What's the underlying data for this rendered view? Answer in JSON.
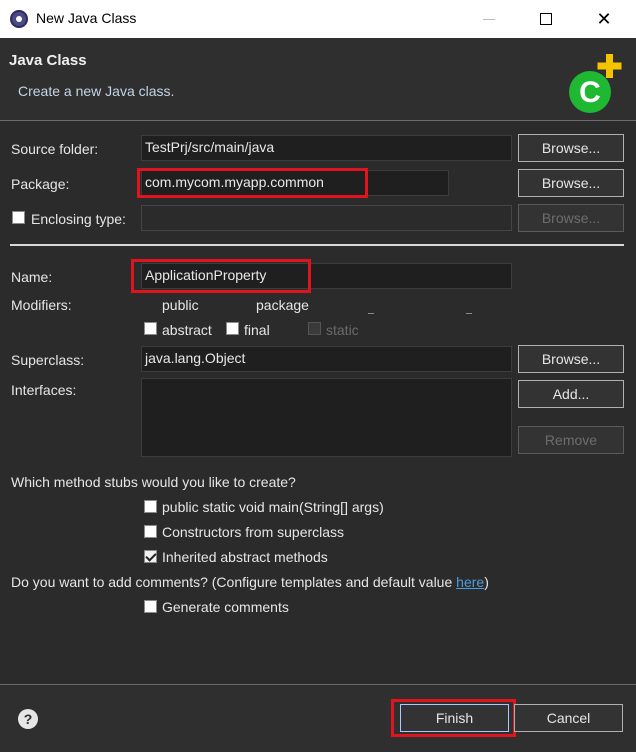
{
  "window": {
    "title": "New Java Class"
  },
  "header": {
    "title": "Java Class",
    "description": "Create a new Java class."
  },
  "source_folder": {
    "label": "Source folder:",
    "value": "TestPrj/src/main/java",
    "browse": "Browse..."
  },
  "package": {
    "label": "Package:",
    "value": "com.mycom.myapp.common",
    "browse": "Browse..."
  },
  "enclosing": {
    "label": "Enclosing type:",
    "value": "",
    "browse": "Browse...",
    "checked": false
  },
  "name": {
    "label": "Name:",
    "value": "ApplicationProperty"
  },
  "modifiers": {
    "label": "Modifiers:",
    "options": [
      "public",
      "package"
    ],
    "abstract": "abstract",
    "final": "final",
    "static": "static"
  },
  "superclass": {
    "label": "Superclass:",
    "value": "java.lang.Object",
    "browse": "Browse..."
  },
  "interfaces": {
    "label": "Interfaces:",
    "add": "Add...",
    "remove": "Remove"
  },
  "stubs": {
    "question": "Which method stubs would you like to create?",
    "main": "public static void main(String[] args)",
    "constructors": "Constructors from superclass",
    "inherited": "Inherited abstract methods",
    "main_checked": false,
    "constructors_checked": false,
    "inherited_checked": true
  },
  "comments": {
    "question": "Do you want to add comments? (Configure templates and default value ",
    "link": "here",
    "suffix": ")",
    "generate": "Generate comments",
    "checked": false
  },
  "footer": {
    "finish": "Finish",
    "cancel": "Cancel"
  },
  "colors": {
    "highlight": "#e0141e",
    "icon_green": "#1fb832",
    "icon_plus": "#f5c400"
  }
}
